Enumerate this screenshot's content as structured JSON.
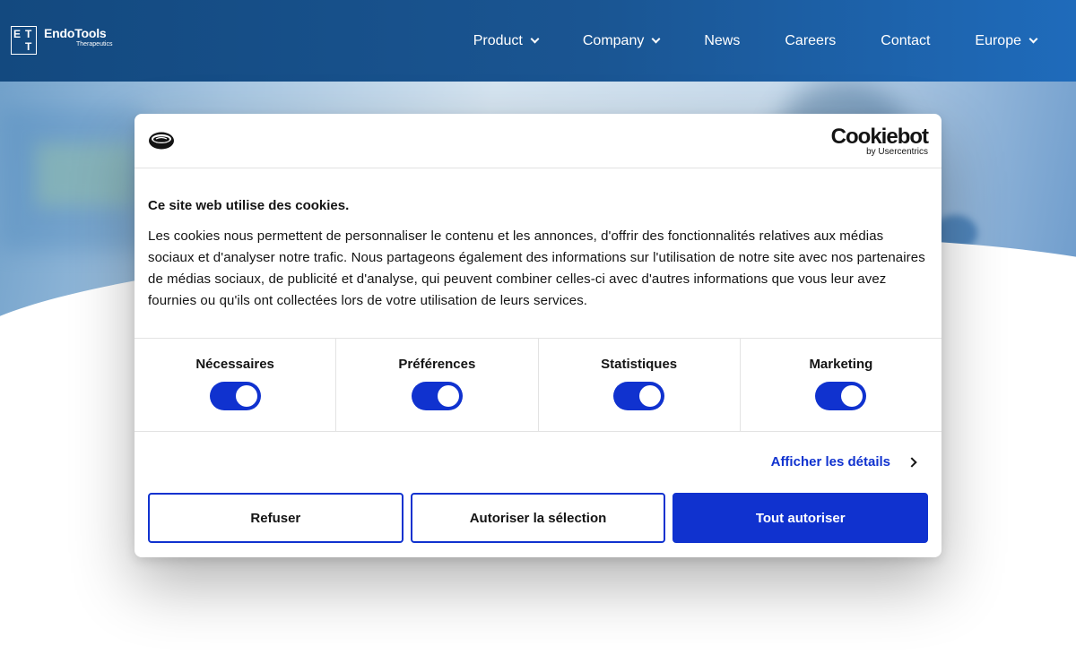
{
  "brand": {
    "logo_letters": [
      "E",
      "T",
      "T"
    ],
    "name_prefix": "Endo",
    "name_suffix": "Tools",
    "tagline": "Therapeutics"
  },
  "nav": {
    "items": [
      {
        "label": "Product",
        "has_dropdown": true
      },
      {
        "label": "Company",
        "has_dropdown": true
      },
      {
        "label": "News",
        "has_dropdown": false
      },
      {
        "label": "Careers",
        "has_dropdown": false
      },
      {
        "label": "Contact",
        "has_dropdown": false
      },
      {
        "label": "Europe",
        "has_dropdown": true
      }
    ]
  },
  "cookie_dialog": {
    "provider_name": "Cookiebot",
    "provider_by": "by Usercentrics",
    "title": "Ce site web utilise des cookies.",
    "description": "Les cookies nous permettent de personnaliser le contenu et les annonces, d'offrir des fonctionnalités relatives aux médias sociaux et d'analyser notre trafic. Nous partageons également des informations sur l'utilisation de notre site avec nos partenaires de médias sociaux, de publicité et d'analyse, qui peuvent combiner celles-ci avec d'autres informations que vous leur avez fournies ou qu'ils ont collectées lors de votre utilisation de leurs services.",
    "toggles": [
      {
        "label": "Nécessaires",
        "checked": true
      },
      {
        "label": "Préférences",
        "checked": true
      },
      {
        "label": "Statistiques",
        "checked": true
      },
      {
        "label": "Marketing",
        "checked": true
      }
    ],
    "details_link": "Afficher les détails",
    "buttons": {
      "refuse": "Refuser",
      "allow_selection": "Autoriser la sélection",
      "allow_all": "Tout autoriser"
    }
  },
  "colors": {
    "header_start": "#13497f",
    "header_end": "#1f6bbb",
    "accent": "#1032cf",
    "text": "#141414"
  }
}
